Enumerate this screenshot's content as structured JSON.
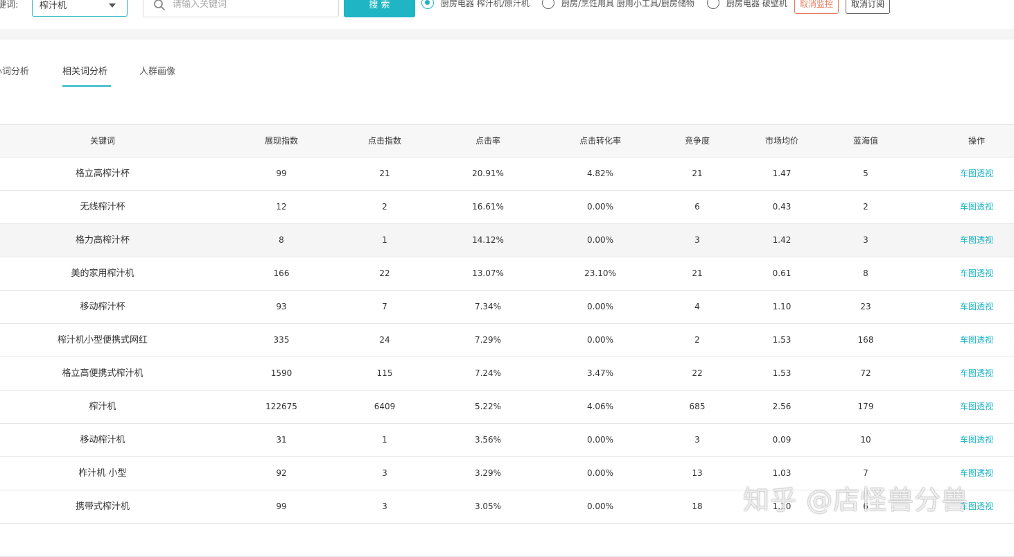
{
  "search": {
    "keyword_label": "键词:",
    "selected_type": "榨汁机",
    "placeholder": "请输入关键词",
    "search_button": "搜 索"
  },
  "categories": [
    {
      "label": "厨房电器 榨汁机/原汁机",
      "checked": true
    },
    {
      "label": "厨房/烹饪用具 厨用小工具/厨房储物",
      "checked": false
    },
    {
      "label": "厨房电器 破壁机",
      "checked": false
    }
  ],
  "actions": {
    "cancel_monitor": "取消监控",
    "cancel_subscribe": "取消订阅"
  },
  "tabs": [
    {
      "label": "核心词分析"
    },
    {
      "label": "相关词分析"
    },
    {
      "label": "人群画像"
    }
  ],
  "active_tab": "相关词分析",
  "table": {
    "headers": [
      "关键词",
      "展现指数",
      "点击指数",
      "点击率",
      "点击转化率",
      "竞争度",
      "市场均价",
      "蓝海值",
      "操作"
    ],
    "action_label": "车图透视",
    "rows": [
      [
        "格立高榨汁杯",
        "99",
        "21",
        "20.91%",
        "4.82%",
        "21",
        "1.47",
        "5"
      ],
      [
        "无线榨汁杯",
        "12",
        "2",
        "16.61%",
        "0.00%",
        "6",
        "0.43",
        "2"
      ],
      [
        "格力高榨汁杯",
        "8",
        "1",
        "14.12%",
        "0.00%",
        "3",
        "1.42",
        "3"
      ],
      [
        "美的家用榨汁机",
        "166",
        "22",
        "13.07%",
        "23.10%",
        "21",
        "0.61",
        "8"
      ],
      [
        "移动榨汁杯",
        "93",
        "7",
        "7.34%",
        "0.00%",
        "4",
        "1.10",
        "23"
      ],
      [
        "榨汁机小型便携式网红",
        "335",
        "24",
        "7.29%",
        "0.00%",
        "2",
        "1.53",
        "168"
      ],
      [
        "格立高便携式榨汁机",
        "1590",
        "115",
        "7.24%",
        "3.47%",
        "22",
        "1.53",
        "72"
      ],
      [
        "榨汁机",
        "122675",
        "6409",
        "5.22%",
        "4.06%",
        "685",
        "2.56",
        "179"
      ],
      [
        "移动榨汁机",
        "31",
        "1",
        "3.56%",
        "0.00%",
        "3",
        "0.09",
        "10"
      ],
      [
        "柞汁机 小型",
        "92",
        "3",
        "3.29%",
        "0.00%",
        "13",
        "1.03",
        "7"
      ],
      [
        "携带式榨汁机",
        "99",
        "3",
        "3.05%",
        "0.00%",
        "18",
        "1.10",
        "6"
      ],
      [
        "",
        "",
        "",
        "",
        "",
        "",
        "",
        ""
      ]
    ]
  },
  "watermark": "知乎 @店怪兽分兽",
  "colors": {
    "accent": "#1fb5c4",
    "warning_button": "#e8795a",
    "header_bg": "#f7f7f7",
    "hover_row_bg": "#f5f5f5"
  },
  "icons": [
    "search-icon",
    "chevron-down-icon"
  ]
}
